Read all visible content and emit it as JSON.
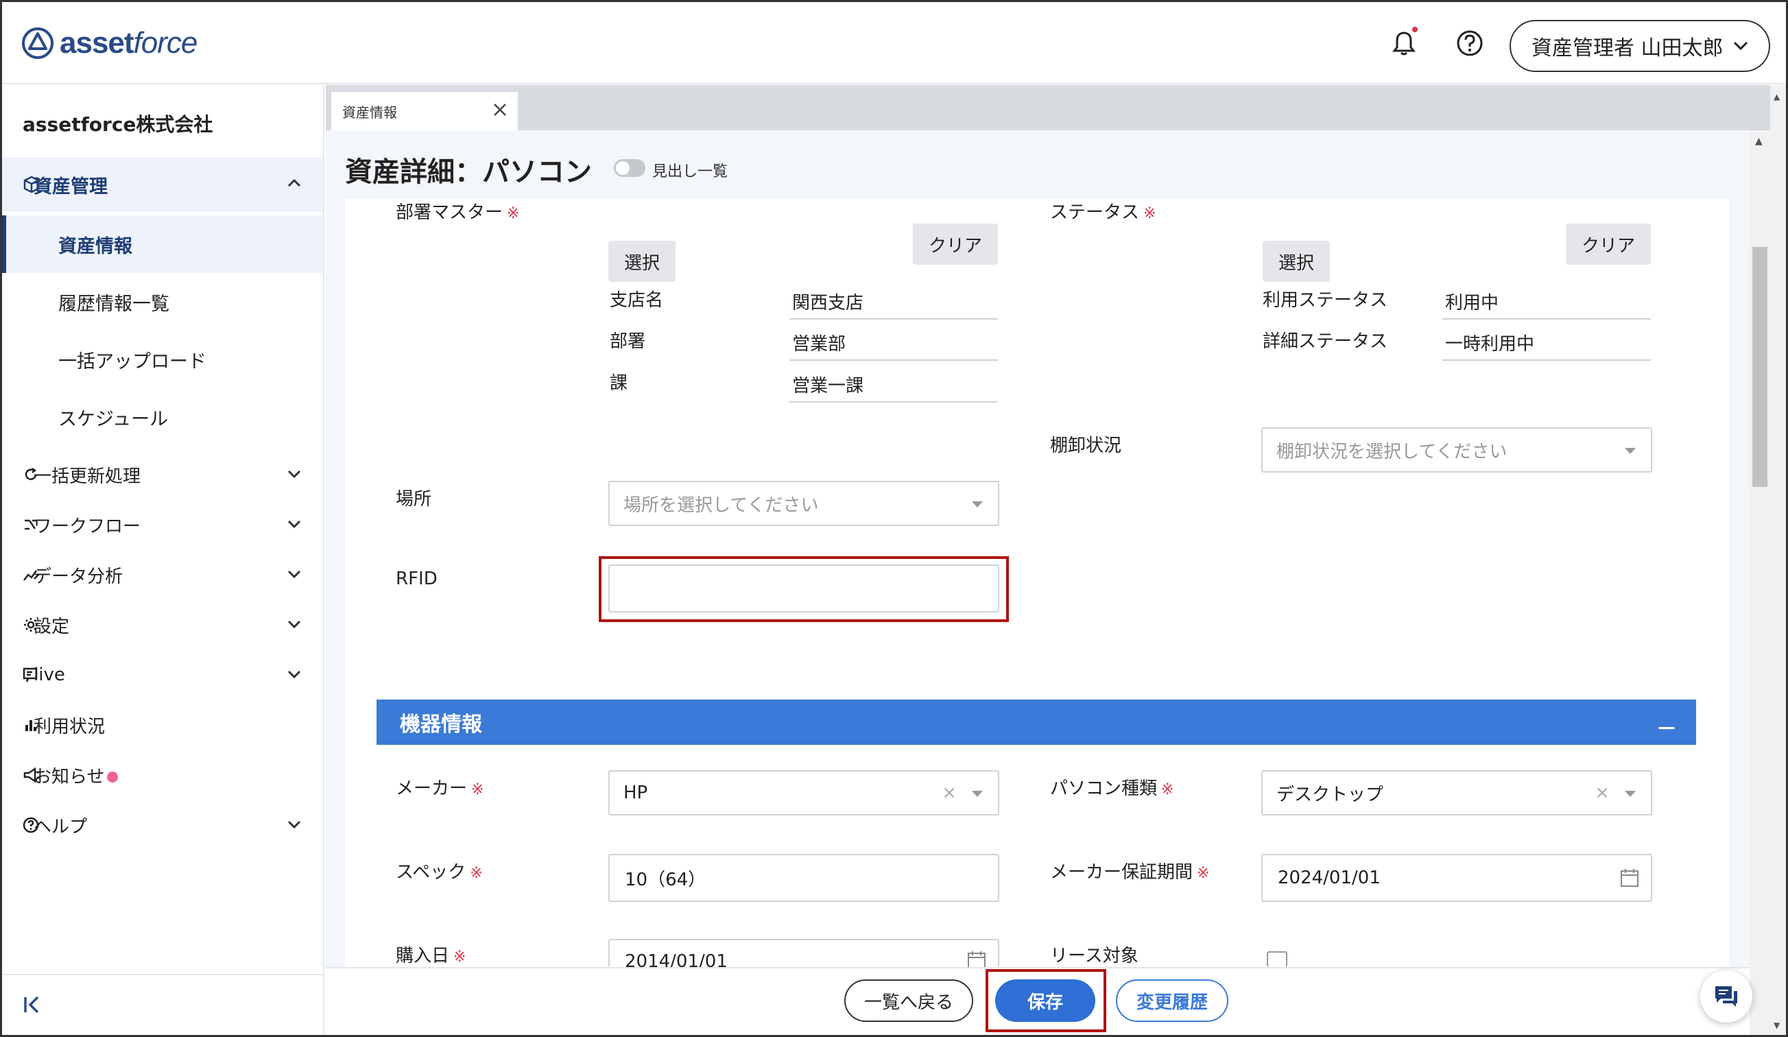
{
  "header": {
    "logo_text_bold": "asset",
    "logo_text_italic": "force",
    "user_label": "資産管理者 山田太郎"
  },
  "sidebar": {
    "company": "assetforce株式会社",
    "group": {
      "label": "資産管理",
      "icon": "cube-icon"
    },
    "sub_items": [
      {
        "label": "資産情報",
        "active": true
      },
      {
        "label": "履歴情報一覧"
      },
      {
        "label": "一括アップロード"
      },
      {
        "label": "スケジュール"
      }
    ],
    "items": [
      {
        "label": "一括更新処理",
        "icon": "refresh-icon",
        "expandable": true
      },
      {
        "label": "ワークフロー",
        "icon": "workflow-icon",
        "expandable": true
      },
      {
        "label": "データ分析",
        "icon": "analytics-icon",
        "expandable": true
      },
      {
        "label": "設定",
        "icon": "gear-icon",
        "expandable": true
      },
      {
        "label": "live",
        "icon": "live-icon",
        "expandable": true
      },
      {
        "label": "利用状況",
        "icon": "bar-chart-icon",
        "expandable": false
      },
      {
        "label": "お知らせ",
        "icon": "megaphone-icon",
        "expandable": false
      },
      {
        "label": "ヘルプ",
        "icon": "help-circle-icon",
        "expandable": true
      }
    ]
  },
  "tab": {
    "label": "資産情報"
  },
  "page": {
    "title": "資産詳細：パソコン",
    "toggle_label": "見出し一覧"
  },
  "form": {
    "dept": {
      "label": "部署マスター",
      "required_mark": "※",
      "select_btn": "選択",
      "clear_btn": "クリア",
      "fields": [
        {
          "key": "支店名",
          "value": "関西支店"
        },
        {
          "key": "部署",
          "value": "営業部"
        },
        {
          "key": "課",
          "value": "営業一課"
        }
      ]
    },
    "status": {
      "label": "ステータス",
      "required_mark": "※",
      "select_btn": "選択",
      "clear_btn": "クリア",
      "fields": [
        {
          "key": "利用ステータス",
          "value": "利用中"
        },
        {
          "key": "詳細ステータス",
          "value": "一時利用中"
        }
      ]
    },
    "inventory": {
      "label": "棚卸状況",
      "placeholder": "棚卸状況を選択してください"
    },
    "location": {
      "label": "場所",
      "placeholder": "場所を選択してください"
    },
    "rfid": {
      "label": "RFID",
      "value": ""
    },
    "section_title": "機器情報",
    "section_toggle": "－",
    "maker": {
      "label": "メーカー",
      "required_mark": "※",
      "value": "HP",
      "clear": "×"
    },
    "pc_type": {
      "label": "パソコン種類",
      "required_mark": "※",
      "value": "デスクトップ",
      "clear": "×"
    },
    "spec": {
      "label": "スペック",
      "required_mark": "※",
      "value": "10（64）"
    },
    "warranty": {
      "label": "メーカー保証期間",
      "required_mark": "※",
      "value": "2024/01/01"
    },
    "purchase": {
      "label": "購入日",
      "required_mark": "※",
      "value": "2014/01/01"
    },
    "lease": {
      "label": "リース対象"
    }
  },
  "footer": {
    "back": "一覧へ戻る",
    "save": "保存",
    "history": "変更履歴"
  },
  "colors": {
    "accent": "#3b7ad6",
    "primary_button": "#2f6fd6",
    "nav_active": "#1f3e75",
    "required": "#e0304a",
    "highlight_box": "#b01010"
  }
}
